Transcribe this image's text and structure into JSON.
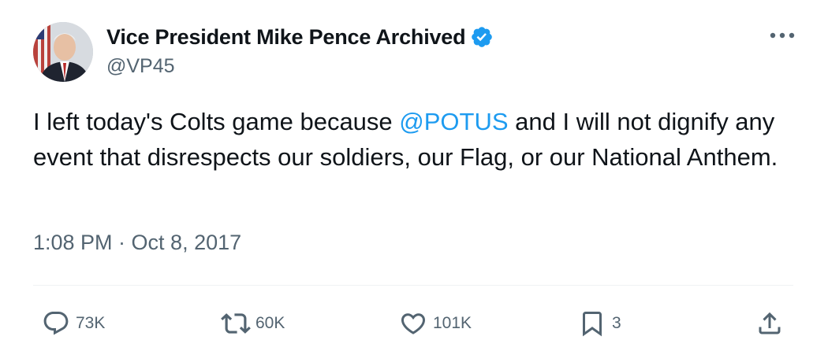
{
  "author": {
    "display_name": "Vice President Mike Pence Archived",
    "handle": "@VP45",
    "verified": true
  },
  "tweet": {
    "text_before": "I left today's Colts game because ",
    "mention": "@POTUS",
    "text_after": " and I will not dignify any event that disrespects our soldiers, our Flag, or our National Anthem.",
    "timestamp": "1:08 PM · Oct 8, 2017"
  },
  "actions": {
    "replies": "73K",
    "reposts": "60K",
    "likes": "101K",
    "bookmarks": "3"
  },
  "icons": {
    "verified": "verified-badge-icon",
    "more": "more-options-icon",
    "reply": "reply-icon",
    "repost": "repost-icon",
    "like": "heart-icon",
    "bookmark": "bookmark-icon",
    "share": "share-icon"
  },
  "colors": {
    "accent": "#1d9bf0",
    "text": "#0f1419",
    "secondary": "#536471"
  }
}
